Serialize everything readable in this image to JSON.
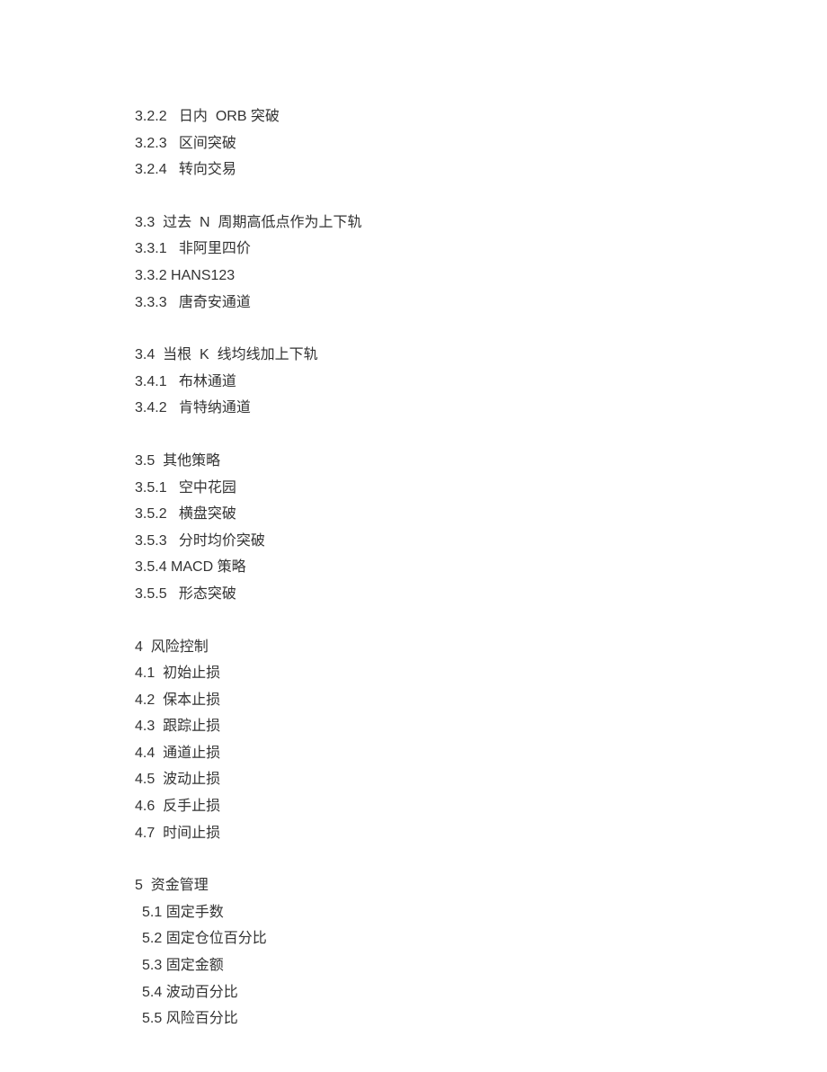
{
  "toc": {
    "group_322": [
      "3.2.2   日内  ORB 突破",
      "3.2.3   区间突破",
      "3.2.4   转向交易"
    ],
    "group_33": [
      "3.3  过去  N  周期高低点作为上下轨",
      "3.3.1   非阿里四价",
      "3.3.2 HANS123",
      "3.3.3   唐奇安通道"
    ],
    "group_34": [
      "3.4  当根  K  线均线加上下轨",
      "3.4.1   布林通道",
      "3.4.2   肯特纳通道"
    ],
    "group_35": [
      "3.5  其他策略",
      "3.5.1   空中花园",
      "3.5.2   横盘突破",
      "3.5.3   分时均价突破",
      "3.5.4 MACD 策略",
      "3.5.5   形态突破"
    ],
    "group_4": [
      "4  风险控制",
      "4.1  初始止损",
      "4.2  保本止损",
      "4.3  跟踪止损",
      "4.4  通道止损",
      "4.5  波动止损",
      "4.6  反手止损",
      "4.7  时间止损"
    ],
    "group_5_heading": "5  资金管理",
    "group_5_items": [
      "5.1 固定手数",
      "5.2 固定仓位百分比",
      "5.3 固定金额",
      "5.4 波动百分比",
      "5.5 风险百分比"
    ]
  }
}
